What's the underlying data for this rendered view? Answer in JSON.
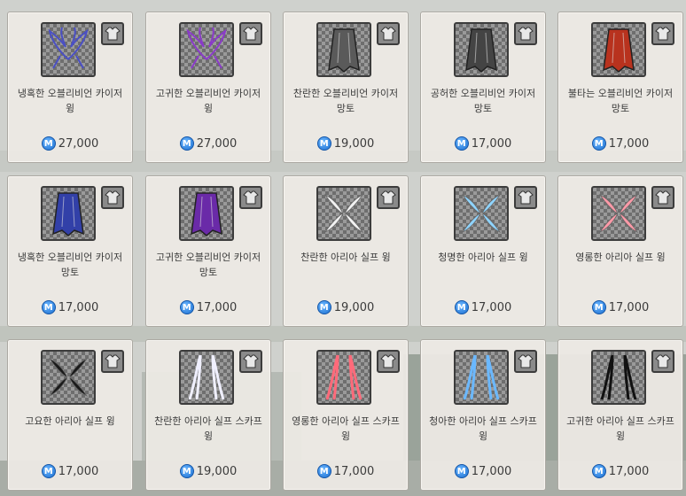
{
  "currency_symbol": "M",
  "items": [
    {
      "name": "냉혹한 오블리비언 카이저 윙",
      "price": "27,000",
      "icon": "wing-icon",
      "color": "#4a4fc4"
    },
    {
      "name": "고귀한 오블리비언 카이저 윙",
      "price": "27,000",
      "icon": "wing-icon",
      "color": "#8a3ac9"
    },
    {
      "name": "찬란한 오블리비언 카이저 망토",
      "price": "19,000",
      "icon": "cape-icon",
      "color": "#5a5a5a"
    },
    {
      "name": "공허한 오블리비언 카이저 망토",
      "price": "17,000",
      "icon": "cape-icon",
      "color": "#444444"
    },
    {
      "name": "불타는 오블리비언 카이저 망토",
      "price": "17,000",
      "icon": "cape-icon",
      "color": "#b8321e"
    },
    {
      "name": "냉혹한 오블리비언 카이저 망토",
      "price": "17,000",
      "icon": "cape-icon",
      "color": "#3240a8"
    },
    {
      "name": "고귀한 오블리비언 카이저 망토",
      "price": "17,000",
      "icon": "cape-icon",
      "color": "#6a2aa8"
    },
    {
      "name": "찬란한 아리아 실프 윙",
      "price": "19,000",
      "icon": "sylph-wing-icon",
      "color": "#f2f2f2"
    },
    {
      "name": "청명한 아리아 실프 윙",
      "price": "17,000",
      "icon": "sylph-wing-icon",
      "color": "#8fd4ff"
    },
    {
      "name": "영롱한 아리아 실프 윙",
      "price": "17,000",
      "icon": "sylph-wing-icon",
      "color": "#ff9aa8"
    },
    {
      "name": "고요한 아리아 실프 윙",
      "price": "17,000",
      "icon": "sylph-wing-icon",
      "color": "#1a1a1a"
    },
    {
      "name": "찬란한 아리아 실프 스카프 윙",
      "price": "19,000",
      "icon": "scarf-wing-icon",
      "color": "#f0f0ff"
    },
    {
      "name": "영롱한 아리아 실프 스카프 윙",
      "price": "17,000",
      "icon": "scarf-wing-icon",
      "color": "#ff6a7a"
    },
    {
      "name": "청아한 아리아 실프 스카프 윙",
      "price": "17,000",
      "icon": "scarf-wing-icon",
      "color": "#6ab8ff"
    },
    {
      "name": "고귀한 아리아 실프 스카프 윙",
      "price": "17,000",
      "icon": "scarf-wing-icon",
      "color": "#111111"
    }
  ]
}
